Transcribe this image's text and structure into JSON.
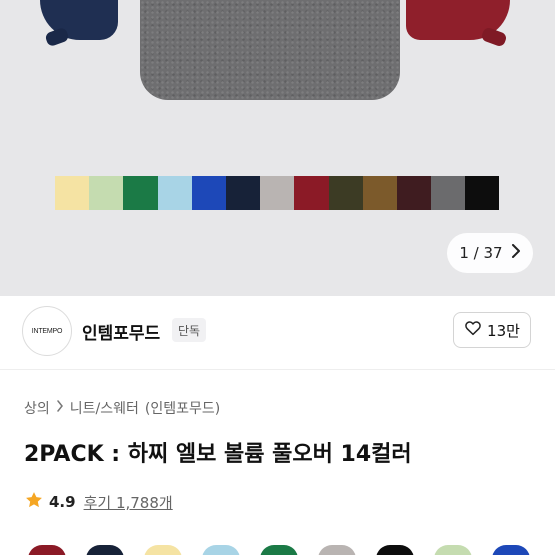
{
  "gallery": {
    "counter_text": "1 / 37",
    "next_icon": "chevron-right-icon",
    "palette": [
      "#f5e3a3",
      "#c5dcb0",
      "#1b7a46",
      "#a8d4e6",
      "#1d48b8",
      "#172238",
      "#b9b4b2",
      "#8b1a26",
      "#3c3b24",
      "#7c5a2b",
      "#3f1c20",
      "#6b6b6d",
      "#0d0d0d"
    ],
    "sweater_colors": {
      "left": "#1f2f52",
      "center": "#6e6e70",
      "right": "#8f1f2b"
    }
  },
  "brand": {
    "logo_text": "INTEMPO",
    "name": "인템포무드",
    "badge": "단독",
    "likes": "13만",
    "like_icon": "heart-outline-icon"
  },
  "breadcrumb": [
    "상의",
    "니트/스웨터",
    "(인템포무드)"
  ],
  "product": {
    "title": "2PACK : 하찌 엘보 볼륨 풀오버 14컬러",
    "rating": "4.9",
    "reviews": "후기 1,788개",
    "star_color": "#f5a623"
  },
  "thumbnail_colors": [
    "#8b1a26",
    "#172238",
    "#f5e3a3",
    "#a8d4e6",
    "#1b7a46",
    "#b9b4b2",
    "#0d0d0d",
    "#c5dcb0",
    "#1d48b8"
  ]
}
